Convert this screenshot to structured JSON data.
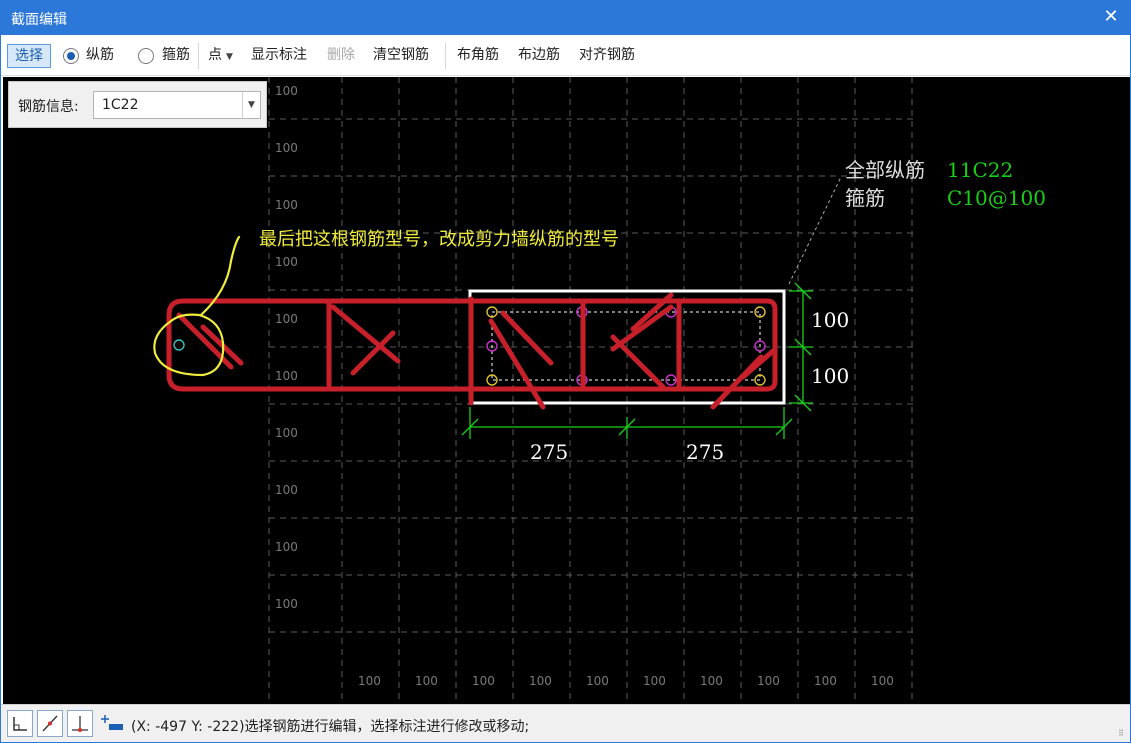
{
  "window": {
    "title": "截面编辑",
    "close_glyph": "✕"
  },
  "toolbar": {
    "select": "选择",
    "longitudinal": "纵筋",
    "stirrup": "箍筋",
    "point": "点",
    "show_dims": "显示标注",
    "delete": "删除",
    "clear_rebar": "清空钢筋",
    "corner_rebar": "布角筋",
    "edge_rebar": "布边筋",
    "align_rebar": "对齐钢筋"
  },
  "info_panel": {
    "label": "钢筋信息:",
    "value": "1C22"
  },
  "drawing": {
    "row_labels": [
      "100",
      "100",
      "100",
      "100",
      "100",
      "100",
      "100",
      "100",
      "100",
      "100"
    ],
    "col_labels": [
      "100",
      "100",
      "100",
      "100",
      "100",
      "100",
      "100",
      "100",
      "100",
      "100"
    ],
    "dim_left": "275",
    "dim_right": "275",
    "dim_top": "100",
    "dim_bottom": "100",
    "all_long_label": "全部纵筋",
    "all_long_value": "11C22",
    "stirrup_label": "箍筋",
    "stirrup_value": "C10@100",
    "annotation": "最后把这根钢筋型号，改成剪力墙纵筋的型号"
  },
  "colors": {
    "titlebar": "#2b78d8",
    "canvas": "#000000",
    "grid": "#5a5a5a",
    "section_outline": "#ffffff",
    "dimension": "#19d019",
    "rebar_corner": "#e0c030",
    "rebar_edge": "#cc33cc",
    "markup_red": "#c8202a",
    "markup_yellow": "#f0ec3c"
  },
  "status": {
    "text": "(X: -497 Y: -222)选择钢筋进行编辑，选择标注进行修改或移动;",
    "buttons": [
      "ortho-icon",
      "snap-icon",
      "perpendicular-icon",
      "insert-icon"
    ]
  }
}
